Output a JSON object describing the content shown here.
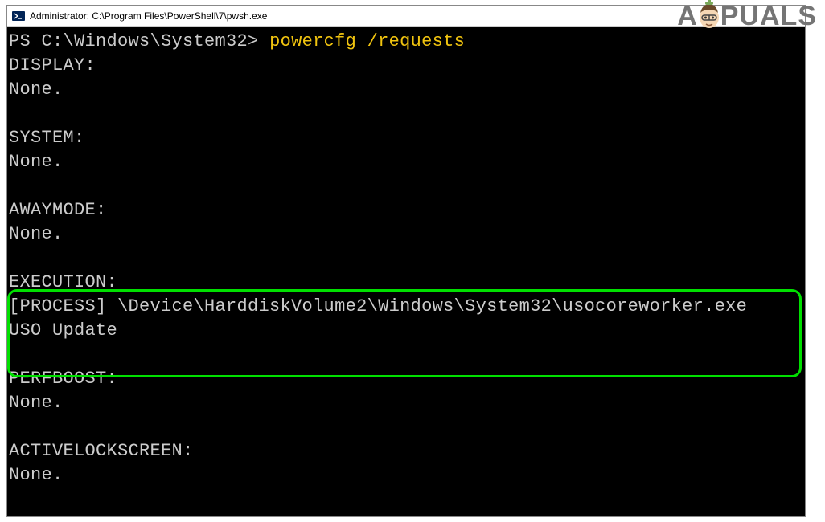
{
  "window": {
    "title": "Administrator: C:\\Program Files\\PowerShell\\7\\pwsh.exe"
  },
  "terminal": {
    "prompt": "PS C:\\Windows\\System32> ",
    "command": "powercfg /requests",
    "sections": {
      "display": {
        "header": "DISPLAY:",
        "value": "None."
      },
      "system": {
        "header": "SYSTEM:",
        "value": "None."
      },
      "awaymode": {
        "header": "AWAYMODE:",
        "value": "None."
      },
      "execution": {
        "header": "EXECUTION:",
        "line1": "[PROCESS] \\Device\\HarddiskVolume2\\Windows\\System32\\usocoreworker.exe",
        "line2": "USO Update"
      },
      "perfboost": {
        "header": "PERFBOOST:",
        "value": "None."
      },
      "activelockscreen": {
        "header": "ACTIVELOCKSCREEN:",
        "value": "None."
      }
    }
  },
  "watermark": {
    "prefix": "A",
    "suffix": "PUALS"
  }
}
